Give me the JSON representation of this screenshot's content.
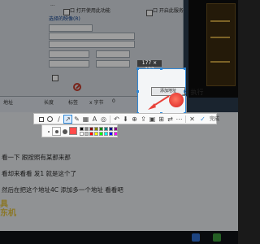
{
  "background_dialog": {
    "rows": [
      {
        "label": "..."
      },
      {
        "label": "口 打开使用此功能"
      },
      {
        "label": "选择的映像(R)"
      },
      {
        "label": "..."
      },
      {
        "label": "口 开启此服务"
      },
      {
        "label": "..."
      }
    ],
    "grid_headers": [
      "地址",
      "长度",
      "标签",
      "x 字节",
      "0"
    ]
  },
  "selection": {
    "size_label": "177 × 123",
    "button_label": "添加地址",
    "outside_text": "上 执行"
  },
  "screenshot_toolbar": {
    "tools": [
      {
        "name": "rectangle-tool-icon"
      },
      {
        "name": "ellipse-tool-icon"
      },
      {
        "name": "pen-tool-icon"
      },
      {
        "name": "arrow-tool-icon"
      },
      {
        "name": "brush-tool-icon"
      },
      {
        "name": "mosaic-tool-icon"
      },
      {
        "name": "text-tool-icon"
      },
      {
        "name": "highlight-tool-icon"
      },
      {
        "name": "undo-icon"
      },
      {
        "name": "save-icon"
      },
      {
        "name": "pin-icon"
      },
      {
        "name": "share-icon"
      },
      {
        "name": "close-icon"
      },
      {
        "name": "check-icon"
      }
    ],
    "done_label": "完成"
  },
  "color_palette": {
    "selected_color": "#ff4b4b",
    "swatches": [
      "#000000",
      "#808080",
      "#800000",
      "#808000",
      "#008000",
      "#008080",
      "#000080",
      "#800080",
      "#ffffff",
      "#c0c0c0",
      "#ff0000",
      "#ffff00",
      "#00ff00",
      "#00ffff",
      "#0000ff",
      "#ff00ff"
    ]
  },
  "transcript_lines": [
    "看一下  跟按照有某那来那",
    "看却来看看   发1    就是这个了",
    "然后在把这个地址4C  添加多一个地址   看看吧"
  ],
  "watermark": {
    "line1": "具",
    "line2": "东机"
  },
  "accent_color": "#2f87d6",
  "marker_color": "#e8423a"
}
